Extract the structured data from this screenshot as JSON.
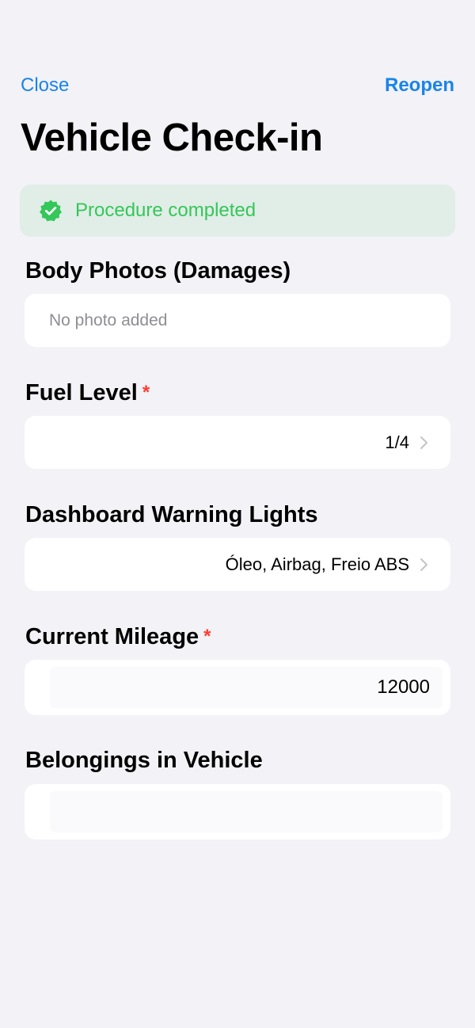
{
  "nav": {
    "close_label": "Close",
    "reopen_label": "Reopen"
  },
  "page": {
    "title": "Vehicle Check-in"
  },
  "banner": {
    "text": "Procedure completed",
    "icon": "check-badge-icon",
    "color": "#34C759",
    "background": "#E1EDE7"
  },
  "fields": {
    "body_photos": {
      "label": "Body Photos (Damages)",
      "placeholder": "No photo added"
    },
    "fuel_level": {
      "label": "Fuel Level",
      "required_mark": "*",
      "value": "1/4"
    },
    "warning_lights": {
      "label": "Dashboard Warning Lights",
      "value": "Óleo, Airbag, Freio ABS"
    },
    "mileage": {
      "label": "Current Mileage",
      "required_mark": "*",
      "value": "12000"
    },
    "belongings": {
      "label": "Belongings in Vehicle",
      "value": ""
    }
  },
  "colors": {
    "accent": "#1A84E8",
    "required": "#FF3B30",
    "background": "#F2F2F7",
    "placeholder": "#8E8E93"
  }
}
